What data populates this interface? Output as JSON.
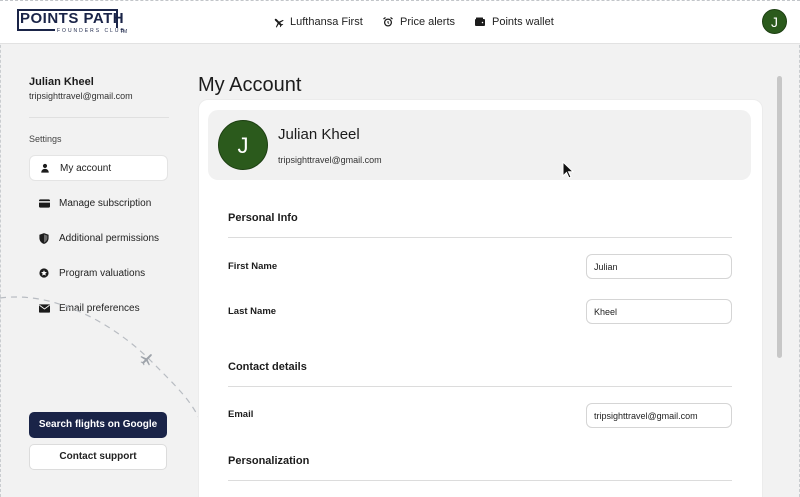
{
  "brand": {
    "logo_main": "POINTS PATH",
    "logo_sub": "FOUNDERS CLUB",
    "logo_tm": "TM",
    "navy": "#1a2448"
  },
  "nav": {
    "items": [
      {
        "label": "Lufthansa First",
        "icon": "plane-icon"
      },
      {
        "label": "Price alerts",
        "icon": "alarm-clock-icon"
      },
      {
        "label": "Points wallet",
        "icon": "wallet-icon"
      }
    ],
    "avatar_initial": "J"
  },
  "sidebar": {
    "user_name": "Julian Kheel",
    "user_email": "tripsighttravel@gmail.com",
    "heading": "Settings",
    "items": [
      {
        "label": "My account",
        "icon": "person-icon",
        "active": true
      },
      {
        "label": "Manage subscription",
        "icon": "card-icon",
        "active": false
      },
      {
        "label": "Additional permissions",
        "icon": "shield-icon",
        "active": false
      },
      {
        "label": "Program valuations",
        "icon": "badge-icon",
        "active": false
      },
      {
        "label": "Email preferences",
        "icon": "envelope-icon",
        "active": false
      }
    ],
    "search_button": "Search flights on Google",
    "support_button": "Contact support"
  },
  "main": {
    "title": "My Account",
    "profile": {
      "initial": "J",
      "name": "Julian Kheel",
      "email": "tripsighttravel@gmail.com",
      "avatar_color": "#2b5a1c"
    },
    "sections": {
      "personal": "Personal Info",
      "contact": "Contact details",
      "personalization": "Personalization"
    },
    "fields": {
      "first_name_label": "First Name",
      "first_name_value": "Julian",
      "last_name_label": "Last Name",
      "last_name_value": "Kheel",
      "email_label": "Email",
      "email_value": "tripsighttravel@gmail.com"
    }
  }
}
